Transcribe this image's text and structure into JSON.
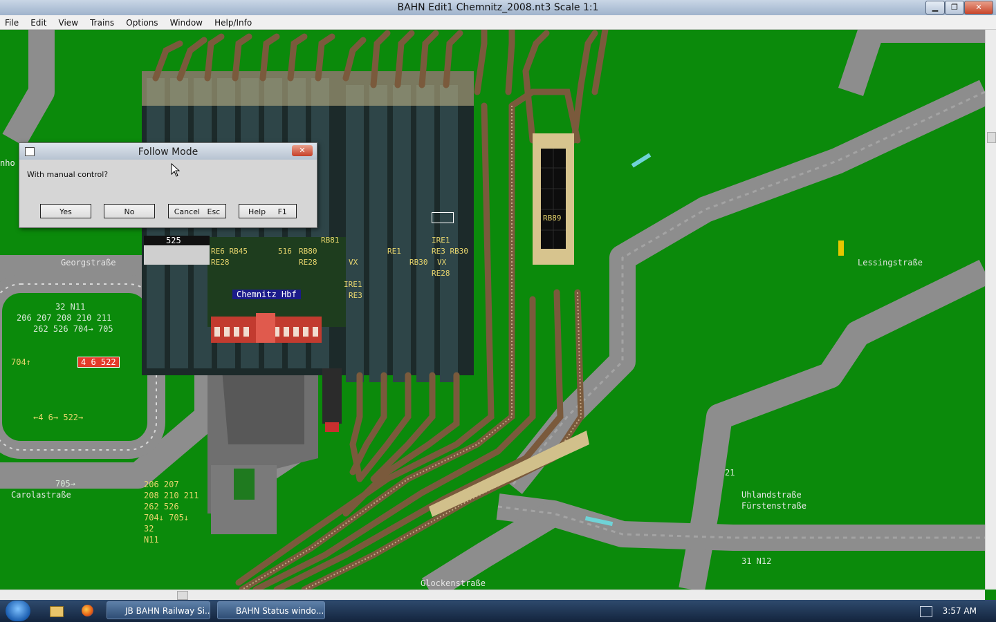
{
  "window": {
    "title": "BAHN Edit1 Chemnitz_2008.nt3 Scale 1:1",
    "minimize": "▁",
    "maximize": "❐",
    "close": "✕"
  },
  "menu": [
    "File",
    "Edit",
    "View",
    "Trains",
    "Options",
    "Window",
    "Help/Info"
  ],
  "dialog": {
    "title": "Follow Mode",
    "close": "✕",
    "message": "With manual control?",
    "buttons": {
      "yes": "Yes",
      "no": "No",
      "cancel": "Cancel   Esc",
      "help": "Help     F1"
    }
  },
  "map_labels": {
    "georgstrasse": "Georgstraße",
    "lessingstrasse": "Lessingstraße",
    "carolastrasse": "Carolastraße",
    "uhlandstrasse": "Uhlandstraße",
    "fuerstenstrasse": "Fürstenstraße",
    "glockenstrasse": "Glockenstraße",
    "station": "Chemnitz Hbf",
    "stop_left_1": "32 N11",
    "stop_left_2": "206 207 208 210 211",
    "stop_left_3": "262 526 704→ 705",
    "stop_left_4": "704↑",
    "stop_left_red": "4 6 522",
    "stop_left_5": "←4 6→ 522→",
    "stop_car_1": "705→",
    "stop_bottom": "206 207\n208 210 211\n262 526\n704↓ 705↓\n32\nN11",
    "stop_uhland_1": "21",
    "stop_uhland_2": "31 N12",
    "platform_525": "525",
    "platform_516": "516",
    "lines_1": "RE6 RB45",
    "lines_1b": "RE28",
    "lines_2": "RB80",
    "lines_2b": "RE28",
    "lines_rb81": "RB81",
    "lines_vx": "VX",
    "lines_ire1": "IRE1",
    "lines_re3": "RE3",
    "lines_re1": "RE1",
    "lines_rb30": "RB30",
    "lines_ire1b": "IRE1",
    "lines_re3b": "RE3 RB30",
    "lines_vxb": "VX",
    "lines_re28": "RE28",
    "lines_rb89": "RB89",
    "left_edge": "nho"
  },
  "taskbar": {
    "items": [
      "JB BAHN Railway Si...",
      "BAHN Status windo..."
    ],
    "clock": "3:57 AM"
  },
  "colors": {
    "grass": "#0b8a0b",
    "road": "#8e8e8e",
    "track": "#7a5a3c",
    "label_yellow": "#e8d66e"
  }
}
